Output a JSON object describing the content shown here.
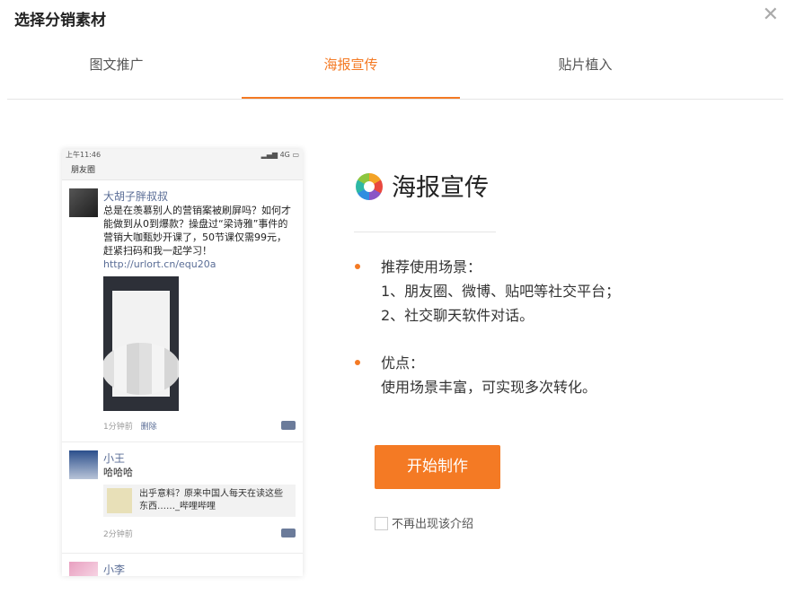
{
  "dialog": {
    "title": "选择分销素材",
    "close_icon": "close-icon"
  },
  "tabs": [
    {
      "label": "图文推广",
      "active": false
    },
    {
      "label": "海报宣传",
      "active": true
    },
    {
      "label": "贴片植入",
      "active": false
    }
  ],
  "phone": {
    "time": "上午11:46",
    "signal": "4G",
    "page_title": "朋友圈",
    "posts": [
      {
        "user": "大胡子胖叔叔",
        "text": "总是在羡慕别人的营销案被刷屏吗？如何才能做到从0到爆款？操盘过“梁诗雅”事件的营销大咖甄妙开课了，50节课仅需99元，赶紧扫码和我一起学习！",
        "link": "http://urlort.cn/equ20a",
        "time": "1分钟前",
        "delete_label": "删除"
      },
      {
        "user": "小王",
        "text": "哈哈哈",
        "share_text": "出乎意料？原来中国人每天在读这些东西……_哔哩哔哩",
        "time": "2分钟前"
      },
      {
        "user": "小李"
      }
    ]
  },
  "intro": {
    "icon": "poster-aperture-icon",
    "title": "海报宣传",
    "scenario_heading": "推荐使用场景：",
    "scenario_items": [
      "1、朋友圈、微博、贴吧等社交平台；",
      "2、社交聊天软件对话。"
    ],
    "advantage_heading": "优点：",
    "advantage_text": "使用场景丰富，可实现多次转化。"
  },
  "start_button": "开始制作",
  "dont_show_label": "不再出现该介绍",
  "colors": {
    "accent": "#f47a24",
    "link": "#5a6d96"
  }
}
